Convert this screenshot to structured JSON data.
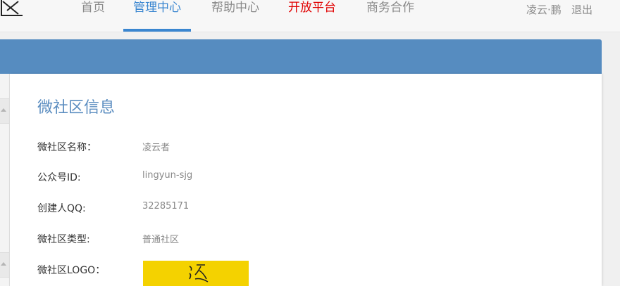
{
  "nav": {
    "items": [
      {
        "label": "首页"
      },
      {
        "label": "管理中心"
      },
      {
        "label": "帮助中心"
      },
      {
        "label": "开放平台"
      },
      {
        "label": "商务合作"
      }
    ],
    "active_index": 1
  },
  "user": {
    "name": "凌云·鹏",
    "logout_label": "退出"
  },
  "info": {
    "title": "微社区信息",
    "fields": [
      {
        "label": "微社区名称：",
        "value": "凌云者"
      },
      {
        "label": "公众号ID:",
        "value": "lingyun-sjg"
      },
      {
        "label": "创建人QQ:",
        "value": "32285171"
      },
      {
        "label": "微社区类型:",
        "value": "普通社区"
      },
      {
        "label": "微社区LOGO："
      }
    ]
  },
  "colors": {
    "accent": "#3a86d0",
    "band": "#568cc0",
    "open_platform": "#e00000",
    "logo_bg": "#f4d200"
  },
  "icons": {
    "logo": "site-logo-icon",
    "community_logo": "community-logo-image"
  }
}
